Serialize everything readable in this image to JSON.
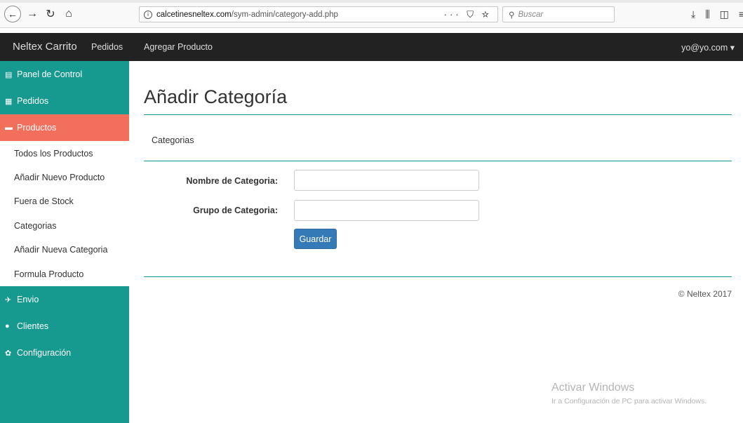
{
  "browser": {
    "url_host": "calcetinesneltex.com",
    "url_path": "/sym-admin/category-add.php",
    "url_actions": "··· ⛉ ☆",
    "search_placeholder": "Buscar"
  },
  "navbar": {
    "brand": "Neltex Carrito",
    "pedidos": "Pedidos",
    "agregar": "Agregar Producto",
    "user": "yo@yo.com ▾"
  },
  "sidebar": {
    "items": [
      {
        "label": "Panel de Control"
      },
      {
        "label": "Pedidos"
      },
      {
        "label": "Productos"
      },
      {
        "label": "Todos los Productos"
      },
      {
        "label": "Añadir Nuevo Producto"
      },
      {
        "label": "Fuera de Stock"
      },
      {
        "label": "Categorias"
      },
      {
        "label": "Añadir Nueva Categoria"
      },
      {
        "label": "Formula Producto"
      },
      {
        "label": "Envio"
      },
      {
        "label": "Clientes"
      },
      {
        "label": "Configuración"
      }
    ]
  },
  "main": {
    "title": "Añadir Categoría",
    "breadcrumb": "Categorias",
    "form": {
      "name_label": "Nombre de Categoria:",
      "name_value": "",
      "group_label": "Grupo de Categoria:",
      "group_value": "",
      "save_label": "Guardar"
    },
    "footer": "© Neltex 2017"
  },
  "watermark": {
    "line1": "Activar Windows",
    "line2": "Ir a Configuración de PC para activar Windows."
  },
  "colors": {
    "teal": "#16998f",
    "active": "#f26f5c",
    "navbar": "#222222",
    "primary_button": "#337ab7"
  }
}
